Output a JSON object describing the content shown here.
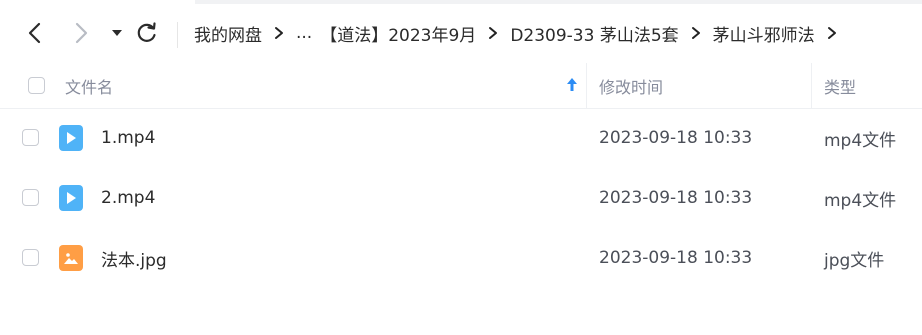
{
  "toolbar": {
    "breadcrumbs": [
      "我的网盘",
      "...",
      "【道法】2023年9月",
      "D2309-33 茅山法5套",
      "茅山斗邪师法"
    ]
  },
  "columns": {
    "name": "文件名",
    "modified": "修改时间",
    "type": "类型"
  },
  "files": [
    {
      "name": "1.mp4",
      "modified": "2023-09-18 10:33",
      "type": "mp4文件",
      "icon": "video-file-icon"
    },
    {
      "name": "2.mp4",
      "modified": "2023-09-18 10:33",
      "type": "mp4文件",
      "icon": "video-file-icon"
    },
    {
      "name": "法本.jpg",
      "modified": "2023-09-18 10:33",
      "type": "jpg文件",
      "icon": "image-file-icon"
    }
  ],
  "colors": {
    "video_icon": "#4fb3f7",
    "image_icon": "#ff9e45",
    "sort_arrow": "#2c8cf4"
  }
}
